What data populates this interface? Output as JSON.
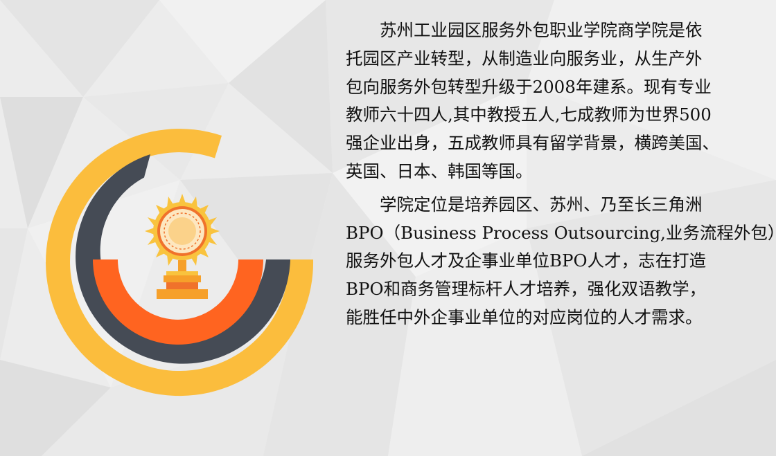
{
  "colors": {
    "background": "#ececec",
    "ring_outer": "#fbbd3d",
    "ring_middle": "#454b55",
    "ring_inner": "#ff6420",
    "trophy_gold": "#f9c33e",
    "trophy_base": "#f6a02a",
    "trophy_orange": "#f0722b"
  },
  "icon": "trophy-medal-icon",
  "content": {
    "paragraphs": [
      "苏州工业园区服务外包职业学院商学院是依\n托园区产业转型，从制造业向服务业，从生产外\n包向服务外包转型升级于2008年建系。现有专业\n教师六十四人,其中教授五人,七成教师为世界500\n强企业出身，五成教师具有留学背景，横跨美国、\n英国、日本、韩国等国。",
      "学院定位是培养园区、苏州、乃至长三角洲\nBPO（Business Process Outsourcing,业务流程外包）\n服务外包人才及企事业单位BPO人才，志在打造\nBPO和商务管理标杆人才培养，强化双语教学，\n能胜任中外企事业单位的对应岗位的人才需求。"
    ]
  }
}
